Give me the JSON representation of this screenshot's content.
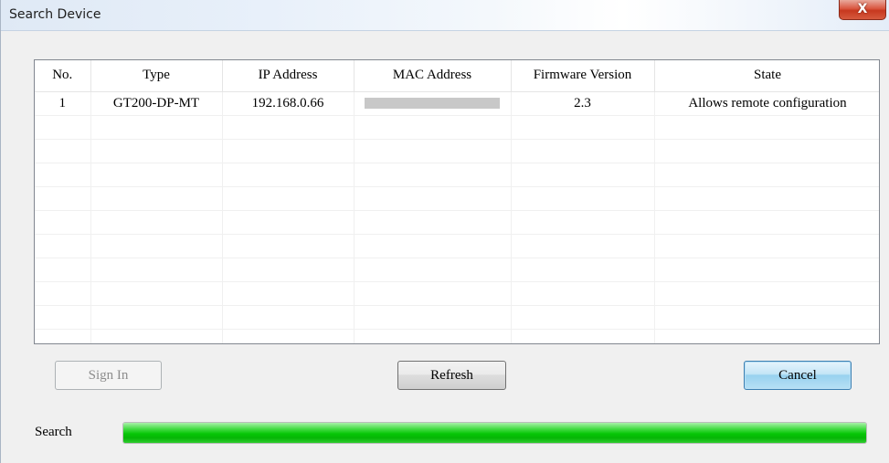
{
  "window": {
    "title": "Search Device",
    "close_label": "X"
  },
  "table": {
    "columns": [
      "No.",
      "Type",
      "IP Address",
      "MAC Address",
      "Firmware Version",
      "State"
    ],
    "rows": [
      {
        "no": "1",
        "type": "GT200-DP-MT",
        "ip": "192.168.0.66",
        "mac": "",
        "firmware": "2.3",
        "state": "Allows remote configuration"
      }
    ]
  },
  "buttons": {
    "sign_in": "Sign In",
    "refresh": "Refresh",
    "cancel": "Cancel"
  },
  "search": {
    "label": "Search",
    "progress_fraction": 1.0
  },
  "colors": {
    "progress": "#06c606",
    "close_button": "#c7381f",
    "default_button": "#98d1ef"
  }
}
